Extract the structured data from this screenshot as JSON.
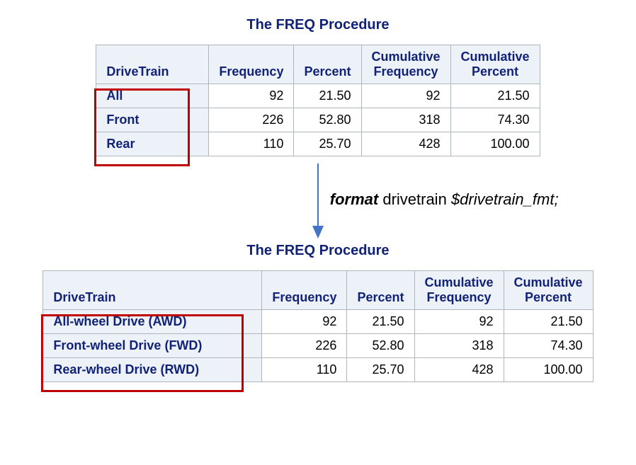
{
  "proc_title": "The FREQ Procedure",
  "headers": {
    "drivetrain": "DriveTrain",
    "frequency": "Frequency",
    "percent": "Percent",
    "cum_freq_line1": "Cumulative",
    "cum_freq_line2": "Frequency",
    "cum_pct_line1": "Cumulative",
    "cum_pct_line2": "Percent"
  },
  "top_table": {
    "rows": [
      {
        "label": "All",
        "freq": "92",
        "pct": "21.50",
        "cfreq": "92",
        "cpct": "21.50"
      },
      {
        "label": "Front",
        "freq": "226",
        "pct": "52.80",
        "cfreq": "318",
        "cpct": "74.30"
      },
      {
        "label": "Rear",
        "freq": "110",
        "pct": "25.70",
        "cfreq": "428",
        "cpct": "100.00"
      }
    ]
  },
  "bottom_table": {
    "rows": [
      {
        "label": "All-wheel Drive (AWD)",
        "freq": "92",
        "pct": "21.50",
        "cfreq": "92",
        "cpct": "21.50"
      },
      {
        "label": "Front-wheel Drive (FWD)",
        "freq": "226",
        "pct": "52.80",
        "cfreq": "318",
        "cpct": "74.30"
      },
      {
        "label": "Rear-wheel Drive (RWD)",
        "freq": "110",
        "pct": "25.70",
        "cfreq": "428",
        "cpct": "100.00"
      }
    ]
  },
  "format_stmt": {
    "keyword": "format",
    "var": "drivetrain",
    "fmt": "$drivetrain_fmt;"
  }
}
